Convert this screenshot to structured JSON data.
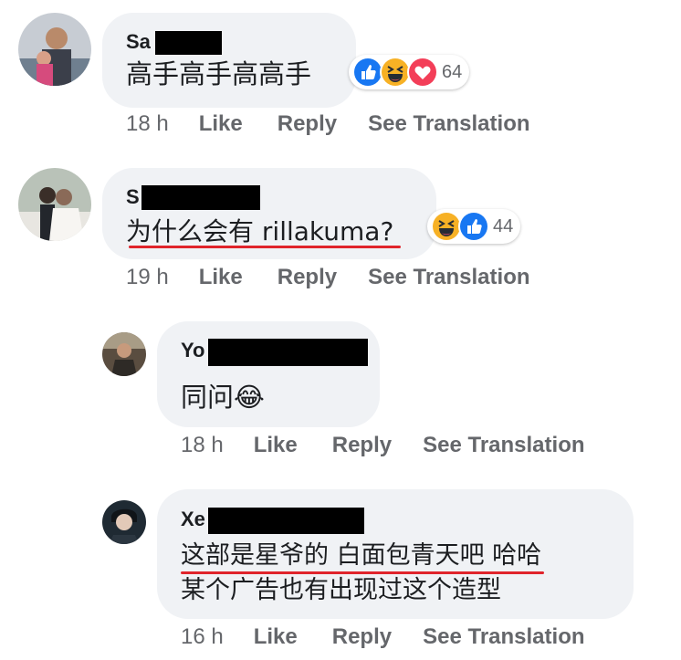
{
  "comments": [
    {
      "author_prefix": "Sa",
      "text": "高手高手高高手",
      "time": "18 h",
      "like": "Like",
      "reply": "Reply",
      "see_translation": "See Translation",
      "reaction_count": "64",
      "reactions": [
        "like-icon",
        "haha-icon",
        "love-icon"
      ]
    },
    {
      "author_prefix": "S",
      "text": "为什么会有 rillakuma?",
      "time": "19 h",
      "like": "Like",
      "reply": "Reply",
      "see_translation": "See Translation",
      "reaction_count": "44",
      "reactions": [
        "haha-icon",
        "like-icon"
      ]
    },
    {
      "author_prefix": "Yo",
      "text": "同问😂",
      "time": "18 h",
      "like": "Like",
      "reply": "Reply",
      "see_translation": "See Translation"
    },
    {
      "author_prefix": "Xe",
      "text_line1": "这部是星爷的 白面包青天吧 哈哈",
      "text_line2": "某个广告也有出现过这个造型",
      "time": "16 h",
      "like": "Like",
      "reply": "Reply",
      "see_translation": "See Translation"
    }
  ],
  "colors": {
    "bubble": "#f0f2f5",
    "meta_text": "#65676b",
    "like_blue": "#1877f2",
    "love_red": "#f33e58",
    "haha_yellow": "#f7b125",
    "underline_red": "#e0242b"
  }
}
